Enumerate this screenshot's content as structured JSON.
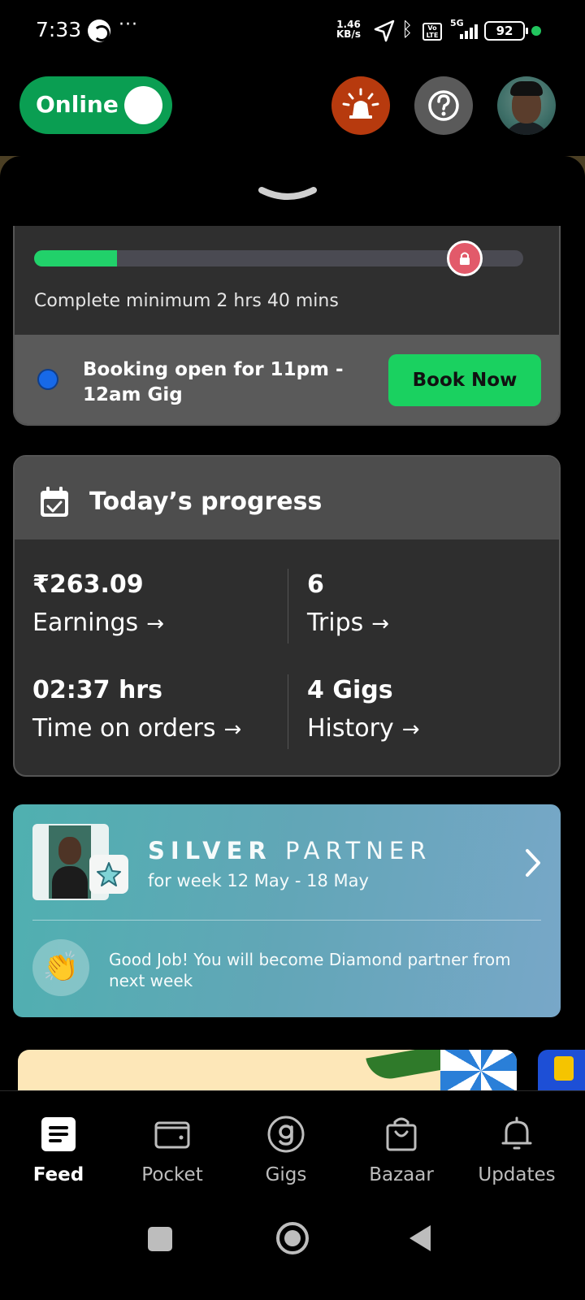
{
  "status_bar": {
    "time": "7:33",
    "more": "···",
    "net_speed_value": "1.46",
    "net_speed_unit": "KB/s",
    "volte": "Vo LTE",
    "network": "5G",
    "battery": "92"
  },
  "header": {
    "toggle_label": "Online",
    "toggle_on": true,
    "colors": {
      "online": "#0a9e52",
      "alarm": "#b73a0e",
      "help": "#5a5a5a"
    }
  },
  "gig_progress": {
    "fill_fraction": 0.17,
    "lock_fraction": 0.88,
    "min_text": "Complete minimum 2 hrs 40 mins",
    "booking_text": "Booking open for 11pm - 12am Gig",
    "book_button": "Book Now"
  },
  "today": {
    "title": "Today’s progress",
    "stats": [
      {
        "value": "₹263.09",
        "label": "Earnings"
      },
      {
        "value": "6",
        "label": "Trips"
      },
      {
        "value": "02:37 hrs",
        "label": "Time on orders"
      },
      {
        "value": "4 Gigs",
        "label": "History"
      }
    ],
    "arrow": "→"
  },
  "partner": {
    "tier": "SILVER",
    "suffix": "PARTNER",
    "week": "for week 12 May - 18 May",
    "message": "Good Job! You will become Diamond partner from next week",
    "clap_emoji": "👏"
  },
  "bottom_nav": {
    "items": [
      {
        "label": "Feed",
        "icon": "feed-icon",
        "active": true
      },
      {
        "label": "Pocket",
        "icon": "wallet-icon",
        "active": false
      },
      {
        "label": "Gigs",
        "icon": "gigs-icon",
        "active": false
      },
      {
        "label": "Bazaar",
        "icon": "shopping-bag-icon",
        "active": false
      },
      {
        "label": "Updates",
        "icon": "bell-icon",
        "active": false
      }
    ]
  }
}
